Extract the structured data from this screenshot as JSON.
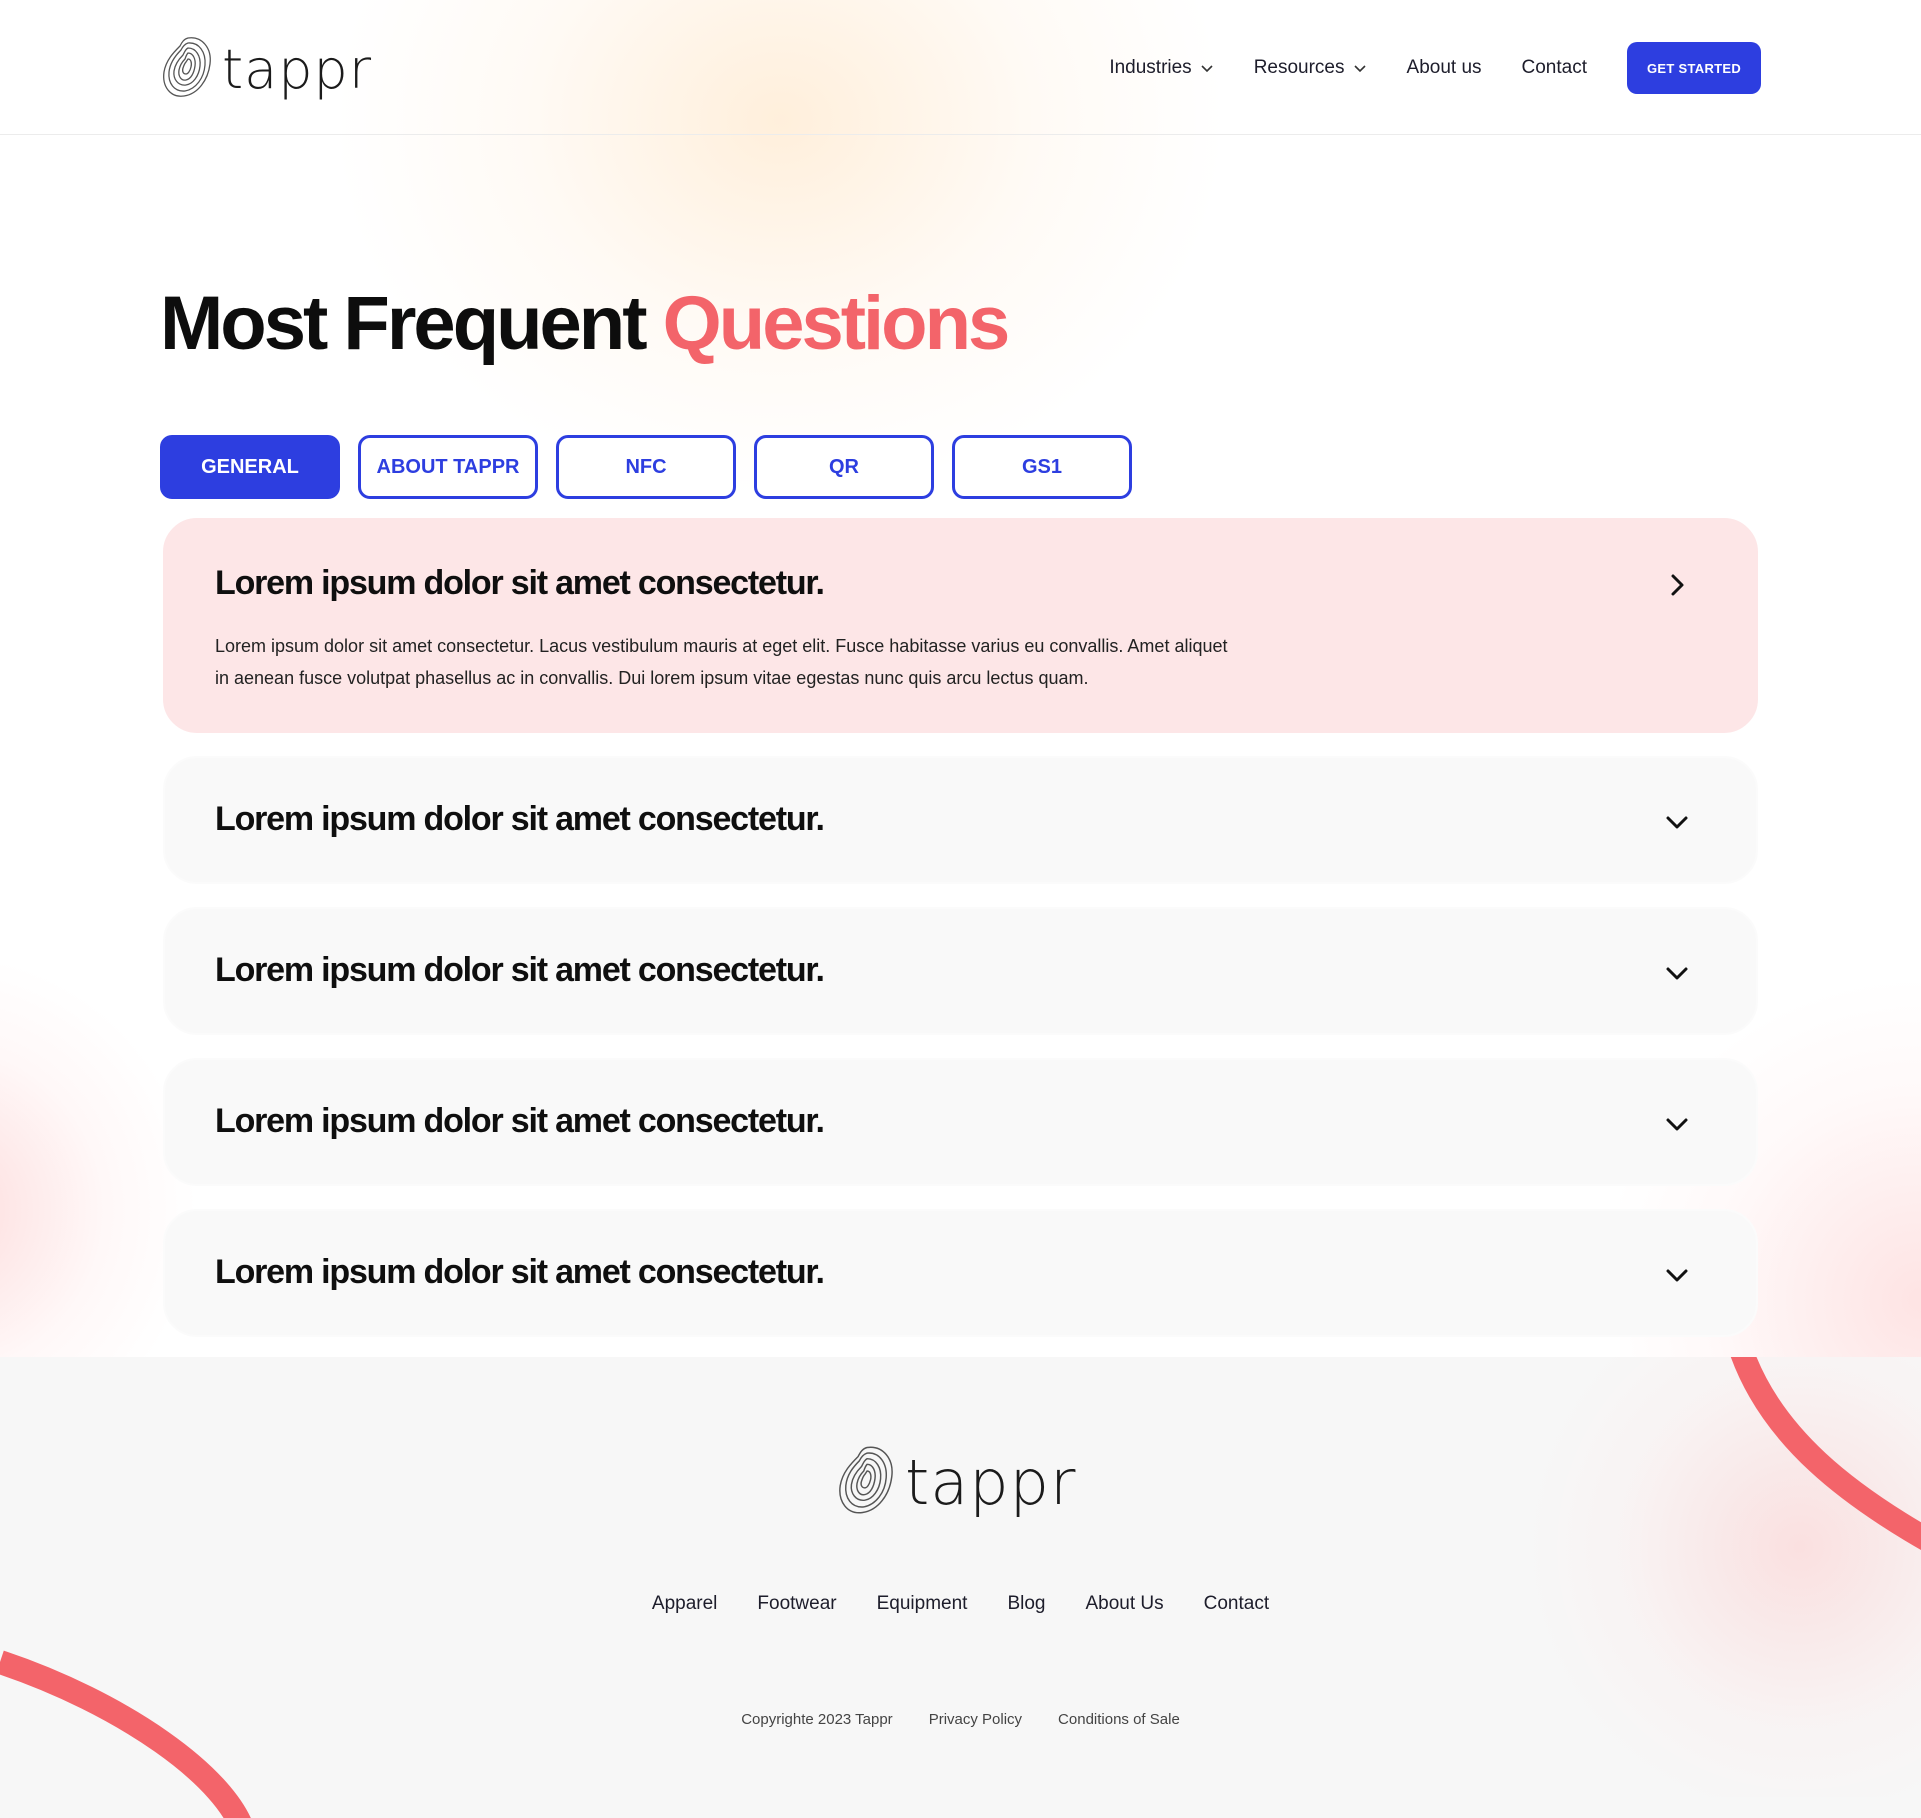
{
  "brand": {
    "name": "tappr",
    "logo_icon": "tappr-swirl-logo-icon",
    "accent": "#f3646a",
    "primary": "#2d3ee0"
  },
  "header": {
    "nav": [
      {
        "label": "Industries",
        "has_dropdown": true
      },
      {
        "label": "Resources",
        "has_dropdown": true
      },
      {
        "label": "About us",
        "has_dropdown": false
      },
      {
        "label": "Contact",
        "has_dropdown": false
      }
    ],
    "cta_label": "GET STARTED"
  },
  "page": {
    "title_main": "Most Frequent",
    "title_accent": "Questions"
  },
  "tabs": [
    {
      "label": "GENERAL",
      "active": true
    },
    {
      "label": "ABOUT TAPPR",
      "active": false
    },
    {
      "label": "NFC",
      "active": false
    },
    {
      "label": "QR",
      "active": false
    },
    {
      "label": "GS1",
      "active": false
    }
  ],
  "faq": [
    {
      "question": "Lorem ipsum dolor sit amet consectetur.",
      "answer": "Lorem ipsum dolor sit amet consectetur. Lacus vestibulum mauris at eget elit. Fusce habitasse varius eu convallis. Amet aliquet in aenean fusce volutpat phasellus ac in convallis. Dui lorem ipsum vitae egestas nunc quis arcu lectus quam.",
      "open": true,
      "icon": "chevron-right-icon"
    },
    {
      "question": "Lorem ipsum dolor sit amet consectetur.",
      "open": false,
      "icon": "chevron-down-icon"
    },
    {
      "question": "Lorem ipsum dolor sit amet consectetur.",
      "open": false,
      "icon": "chevron-down-icon"
    },
    {
      "question": "Lorem ipsum dolor sit amet consectetur.",
      "open": false,
      "icon": "chevron-down-icon"
    },
    {
      "question": "Lorem ipsum dolor sit amet consectetur.",
      "open": false,
      "icon": "chevron-down-icon"
    }
  ],
  "footer": {
    "brand_name": "tappr",
    "links": [
      "Apparel",
      "Footwear",
      "Equipment",
      "Blog",
      "About Us",
      "Contact"
    ],
    "copyright": "Copyrighte 2023 Tappr",
    "legal": [
      "Privacy Policy",
      "Conditions of Sale"
    ]
  }
}
